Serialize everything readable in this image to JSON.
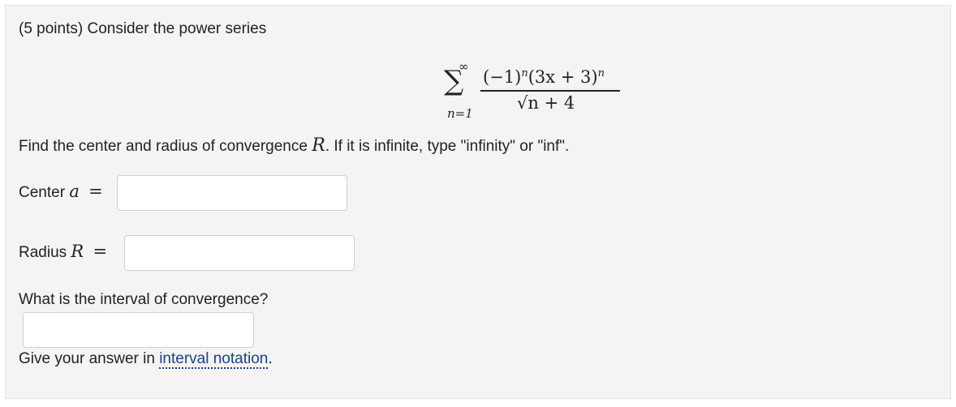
{
  "problem": {
    "intro": "(5 points) Consider the power series",
    "series": {
      "sum_upper": "∞",
      "sum_symbol": "∑",
      "sum_lower": "n=1",
      "numerator_base": "(−1)",
      "numerator_exp1": "n",
      "numerator_mid": "(3x + 3)",
      "numerator_exp2": "n",
      "denominator": "√n + 4"
    },
    "instruction_pre": "Find the center and radius of convergence ",
    "instruction_var": "R",
    "instruction_post": ". If it is infinite, type \"infinity\" or \"inf\".",
    "center_label": "Center ",
    "center_var": "a",
    "radius_label": "Radius ",
    "radius_var": "R",
    "equals": "=",
    "interval_question": "What is the interval of convergence?",
    "answer_hint_pre": "Give your answer in ",
    "answer_hint_link": "interval notation",
    "answer_hint_post": "."
  },
  "inputs": {
    "center_value": "",
    "radius_value": "",
    "interval_value": ""
  }
}
